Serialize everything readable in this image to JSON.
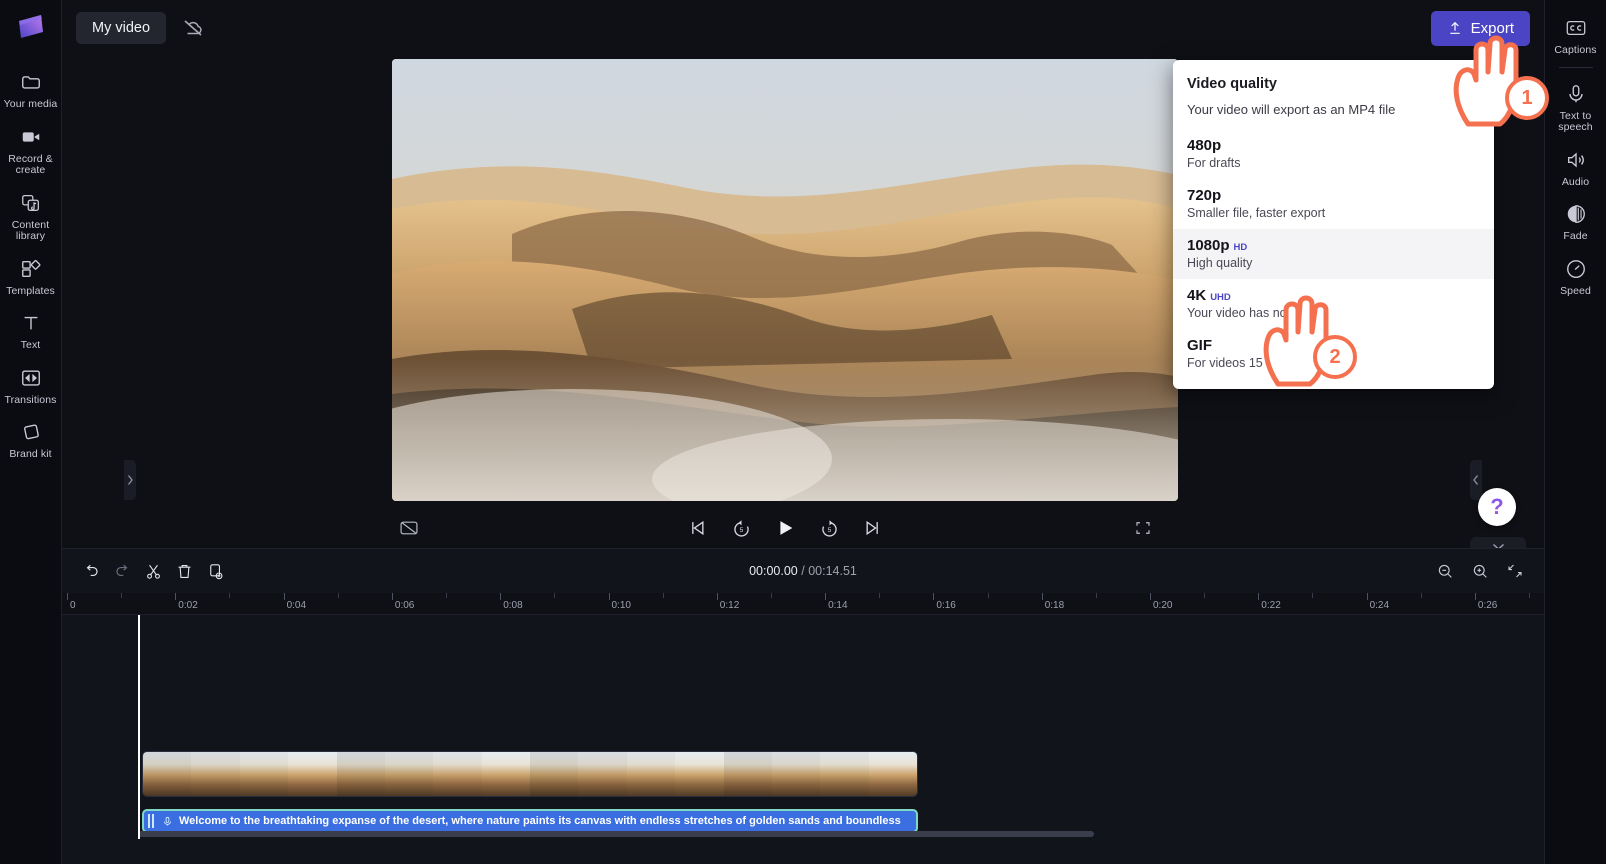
{
  "app": {
    "logo_name": "clipchamp-logo"
  },
  "topbar": {
    "project_title": "My video",
    "cloud_status_icon": "cloud-off-icon",
    "export_label": "Export"
  },
  "left_rail": {
    "items": [
      {
        "label": "Your media",
        "icon": "folder-icon"
      },
      {
        "label": "Record & create",
        "icon": "video-camera-icon"
      },
      {
        "label": "Content library",
        "icon": "content-library-icon"
      },
      {
        "label": "Templates",
        "icon": "templates-icon"
      },
      {
        "label": "Text",
        "icon": "text-icon"
      },
      {
        "label": "Transitions",
        "icon": "transitions-icon"
      },
      {
        "label": "Brand kit",
        "icon": "brand-kit-icon"
      }
    ]
  },
  "right_rail": {
    "items": [
      {
        "label": "Captions",
        "icon": "captions-cc-icon"
      },
      {
        "label": "Text to speech",
        "icon": "text-to-speech-icon"
      },
      {
        "label": "Audio",
        "icon": "audio-speaker-icon"
      },
      {
        "label": "Fade",
        "icon": "fade-icon"
      },
      {
        "label": "Speed",
        "icon": "speed-gauge-icon"
      }
    ]
  },
  "export_menu": {
    "title": "Video quality",
    "subtitle": "Your video will export as an MP4 file",
    "options": [
      {
        "name": "480p",
        "badge": "",
        "desc": "For drafts",
        "highlighted": false
      },
      {
        "name": "720p",
        "badge": "",
        "desc": "Smaller file, faster export",
        "highlighted": false
      },
      {
        "name": "1080p",
        "badge": "HD",
        "desc": "High quality",
        "highlighted": true
      },
      {
        "name": "4K",
        "badge": "UHD",
        "desc": "Your video has no",
        "highlighted": false
      },
      {
        "name": "GIF",
        "badge": "",
        "desc": "For videos 15 seconds or less",
        "highlighted": false
      }
    ],
    "badge_color": "#4b45c6"
  },
  "player": {
    "captions_toggle_icon": "captions-off-icon",
    "controls": [
      {
        "icon": "skip-previous-icon",
        "name": "skip-to-start-button"
      },
      {
        "icon": "rewind-5-icon",
        "name": "rewind-5-seconds-button"
      },
      {
        "icon": "play-icon",
        "name": "play-button"
      },
      {
        "icon": "forward-5-icon",
        "name": "forward-5-seconds-button"
      },
      {
        "icon": "skip-next-icon",
        "name": "skip-to-end-button"
      }
    ],
    "fullscreen_icon": "fullscreen-icon"
  },
  "help": {
    "glyph": "?",
    "color": "#7b5cf0"
  },
  "timeline": {
    "toolbar": [
      {
        "icon": "undo-icon",
        "name": "undo-button"
      },
      {
        "icon": "redo-icon",
        "name": "redo-button"
      },
      {
        "icon": "split-scissors-icon",
        "name": "split-button"
      },
      {
        "icon": "delete-trash-icon",
        "name": "delete-button"
      },
      {
        "icon": "duplicate-icon",
        "name": "duplicate-button"
      }
    ],
    "current_time": "00:00.00",
    "total_time": "00:14.51",
    "time_separator": "/",
    "zoom_out_icon": "zoom-out-icon",
    "zoom_in_icon": "zoom-in-icon",
    "fit_icon": "fit-to-screen-icon",
    "ruler_labels": [
      "0",
      "0:02",
      "0:04",
      "0:06",
      "0:08",
      "0:10",
      "0:12",
      "0:14",
      "0:16",
      "0:18",
      "0:20",
      "0:22",
      "0:24",
      "0:26"
    ],
    "video_clip_name": "desert-video-clip",
    "caption_text": "Welcome to the breathtaking expanse of the desert, where nature paints its canvas with endless stretches of golden sands and boundless",
    "caption_icon": "text-to-speech-clip-icon"
  },
  "annotations": {
    "steps": [
      {
        "number": "1",
        "target": "export-button"
      },
      {
        "number": "2",
        "target": "1080p-option"
      }
    ],
    "accent_color": "#f4704f"
  }
}
